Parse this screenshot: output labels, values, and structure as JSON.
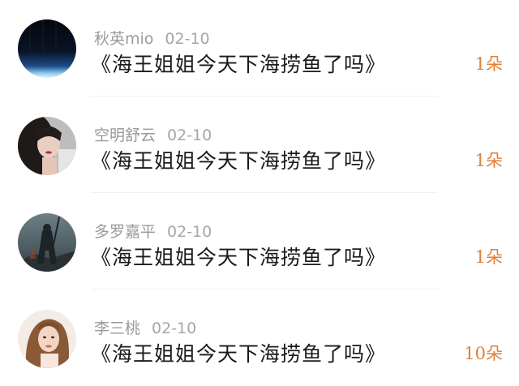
{
  "items": [
    {
      "username": "秋英mio",
      "date": "02-10",
      "title": "《海王姐姐今天下海捞鱼了吗》",
      "count": "1朵",
      "avatar": "night-sky-avatar"
    },
    {
      "username": "空明舒云",
      "date": "02-10",
      "title": "《海王姐姐今天下海捞鱼了吗》",
      "count": "1朵",
      "avatar": "woman-portrait-avatar"
    },
    {
      "username": "多罗嘉平",
      "date": "02-10",
      "title": "《海王姐姐今天下海捞鱼了吗》",
      "count": "1朵",
      "avatar": "warrior-silhouette-avatar"
    },
    {
      "username": "李三桃",
      "date": "02-10",
      "title": "《海王姐姐今天下海捞鱼了吗》",
      "count": "10朵",
      "avatar": "girl-portrait-avatar"
    }
  ],
  "colors": {
    "count": "#e0813a",
    "meta": "#9a9a9a",
    "title": "#1a1a1a"
  }
}
